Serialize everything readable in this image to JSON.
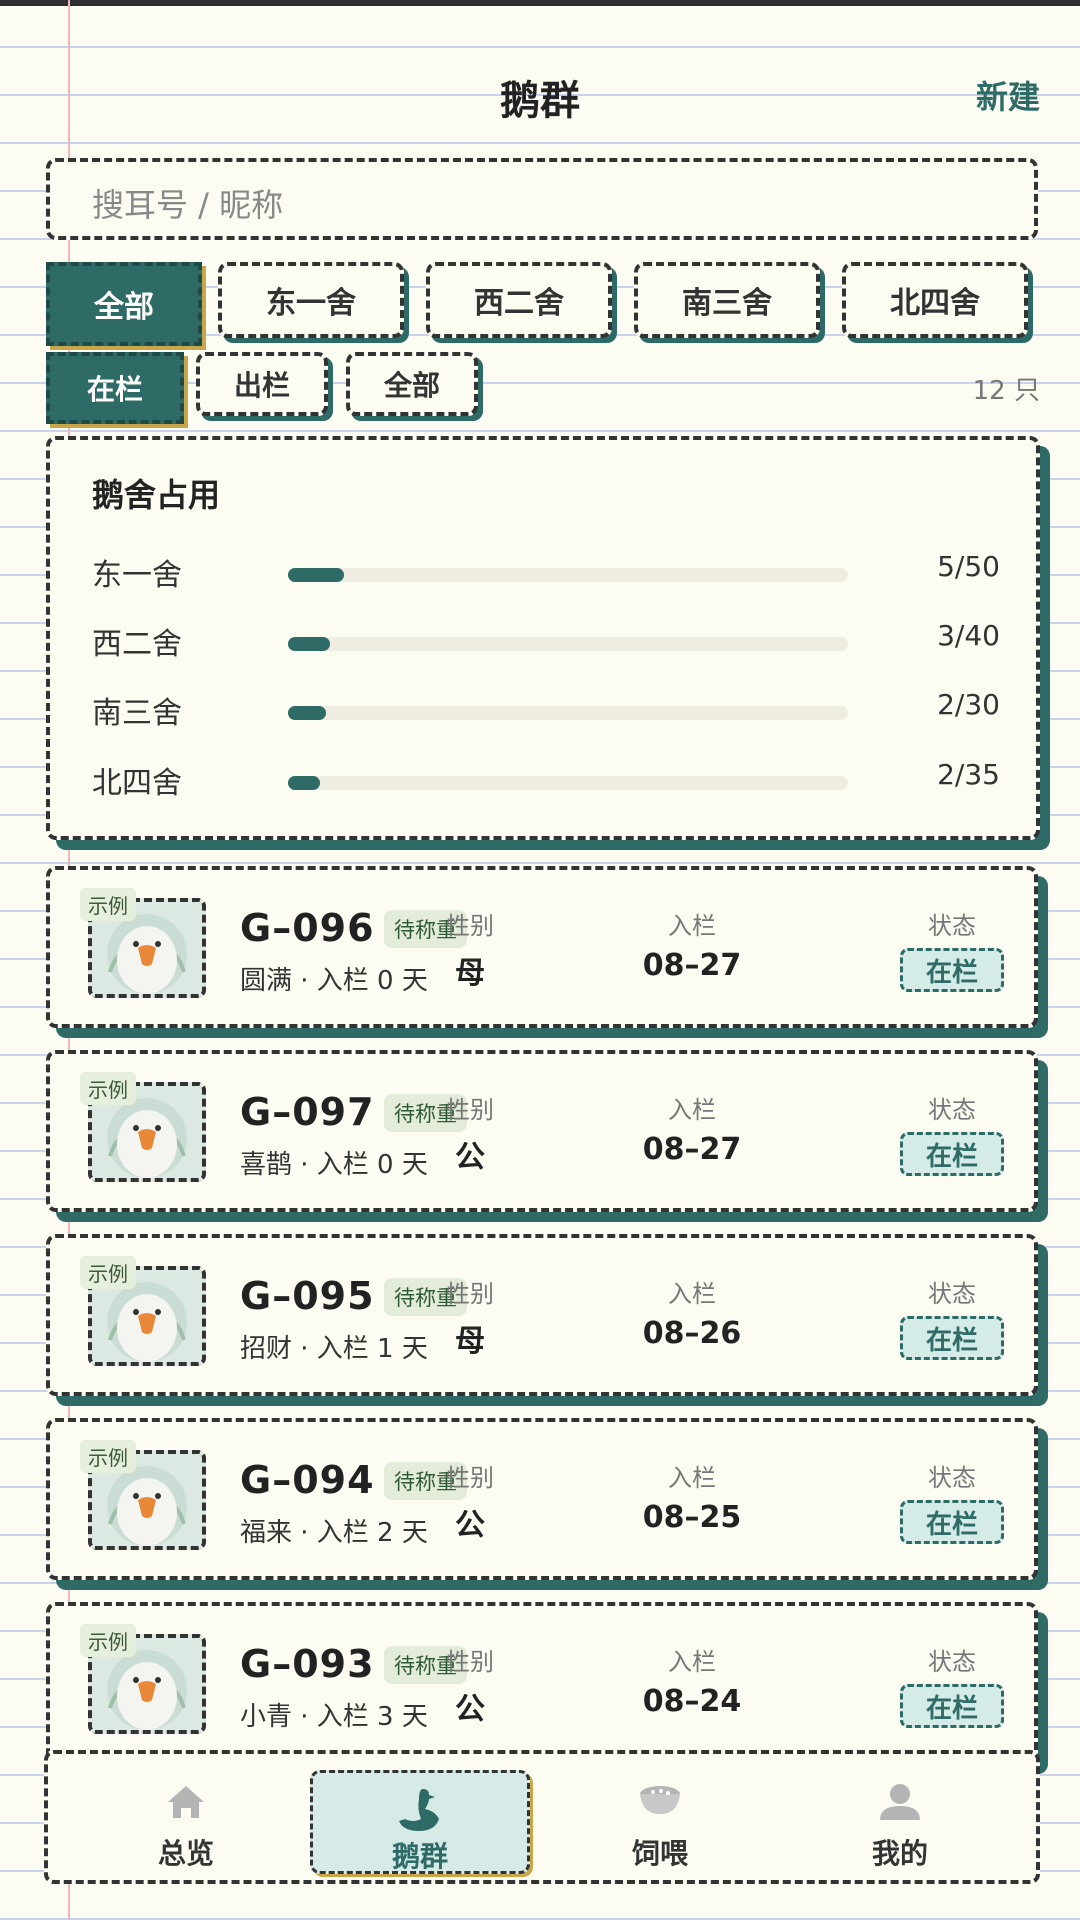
{
  "header": {
    "title": "鹅群",
    "new_label": "新建"
  },
  "search": {
    "placeholder": "搜耳号 / 昵称"
  },
  "house_filters": [
    {
      "label": "全部",
      "active": true
    },
    {
      "label": "东一舍",
      "active": false
    },
    {
      "label": "西二舍",
      "active": false
    },
    {
      "label": "南三舍",
      "active": false
    },
    {
      "label": "北四舍",
      "active": false
    }
  ],
  "status_filters": [
    {
      "label": "在栏",
      "active": true
    },
    {
      "label": "出栏",
      "active": false
    },
    {
      "label": "全部",
      "active": false
    }
  ],
  "count_text": "12 只",
  "occupancy": {
    "title": "鹅舍占用",
    "rows": [
      {
        "name": "东一舍",
        "value": "5/50",
        "ratio": 0.1
      },
      {
        "name": "西二舍",
        "value": "3/40",
        "ratio": 0.075
      },
      {
        "name": "南三舍",
        "value": "2/30",
        "ratio": 0.067
      },
      {
        "name": "北四舍",
        "value": "2/35",
        "ratio": 0.057
      }
    ]
  },
  "geese": [
    {
      "example": "示例",
      "id": "G–096",
      "badge": "待称重",
      "sub": "圆满 · 入栏 0 天",
      "sex_label": "性别",
      "sex": "母",
      "in_label": "入栏",
      "in_date": "08–27",
      "status_label": "状态",
      "status": "在栏"
    },
    {
      "example": "示例",
      "id": "G–097",
      "badge": "待称重",
      "sub": "喜鹊 · 入栏 0 天",
      "sex_label": "性别",
      "sex": "公",
      "in_label": "入栏",
      "in_date": "08–27",
      "status_label": "状态",
      "status": "在栏"
    },
    {
      "example": "示例",
      "id": "G–095",
      "badge": "待称重",
      "sub": "招财 · 入栏 1 天",
      "sex_label": "性别",
      "sex": "母",
      "in_label": "入栏",
      "in_date": "08–26",
      "status_label": "状态",
      "status": "在栏"
    },
    {
      "example": "示例",
      "id": "G–094",
      "badge": "待称重",
      "sub": "福来 · 入栏 2 天",
      "sex_label": "性别",
      "sex": "公",
      "in_label": "入栏",
      "in_date": "08–25",
      "status_label": "状态",
      "status": "在栏"
    },
    {
      "example": "示例",
      "id": "G–093",
      "badge": "待称重",
      "sub": "小青 · 入栏 3 天",
      "sex_label": "性别",
      "sex": "公",
      "in_label": "入栏",
      "in_date": "08–24",
      "status_label": "状态",
      "status": "在栏"
    }
  ],
  "nav": [
    {
      "label": "总览",
      "icon": "home-icon",
      "active": false
    },
    {
      "label": "鹅群",
      "icon": "goose-icon",
      "active": true
    },
    {
      "label": "饲喂",
      "icon": "feed-bowl-icon",
      "active": false
    },
    {
      "label": "我的",
      "icon": "user-icon",
      "active": false
    }
  ],
  "colors": {
    "accent": "#2e6b66",
    "gold": "#c8a64a",
    "paper": "#fdfcf3"
  }
}
